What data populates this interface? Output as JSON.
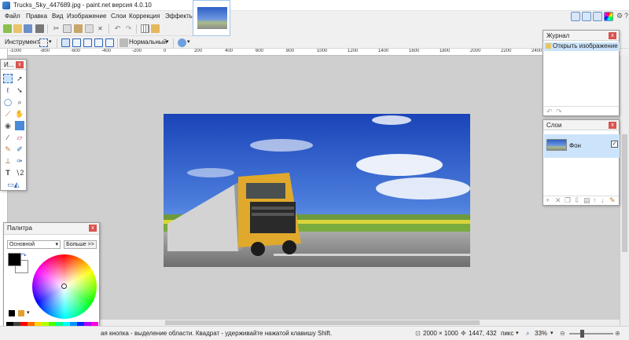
{
  "window": {
    "title": "Trucks_Sky_447689.jpg - paint.net версия 4.0.10",
    "controls": [
      "—",
      "□",
      "✕"
    ]
  },
  "menu": {
    "items": [
      "Файл",
      "Правка",
      "Вид",
      "Изображение",
      "Слои",
      "Коррекция",
      "Эффекты"
    ]
  },
  "toolbar": {
    "tool_label": "Инструмент",
    "blend_mode": "Нормальный"
  },
  "ruler": {
    "labels": [
      "-1000",
      "-800",
      "-600",
      "-400",
      "-200",
      "0",
      "200",
      "400",
      "600",
      "800",
      "1000",
      "1200",
      "1400",
      "1600",
      "1800",
      "2000",
      "2200",
      "2400",
      "2600",
      "2800"
    ]
  },
  "tools_panel": {
    "title": "И..."
  },
  "history": {
    "title": "Журнал",
    "items": [
      "Открыть изображение"
    ]
  },
  "layers": {
    "title": "Слои",
    "items": [
      {
        "name": "Фон",
        "checked": true
      }
    ]
  },
  "palette": {
    "title": "Палитра",
    "mode": "Основной",
    "more_button": "Больше >>",
    "primary_color": "#000000",
    "secondary_color": "#ffffff"
  },
  "status": {
    "hint": "ая кнопка - выделение области. Квадрат - удерживайте нажатой клавишу Shift.",
    "image_size": "2000 × 1000",
    "cursor_pos": "1447, 432",
    "units": "пикс",
    "zoom": "33%"
  },
  "colors": {
    "accent": "#1d6fd1",
    "close": "#d9534f",
    "selection": "#cce4fb"
  }
}
